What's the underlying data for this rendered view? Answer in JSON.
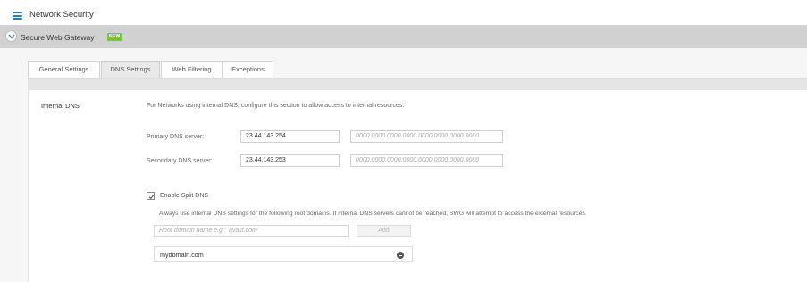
{
  "header": {
    "title": "Network Security",
    "menu_icon": "hamburger-icon"
  },
  "section": {
    "title": "Secure Web Gateway",
    "badge": "NEW",
    "toggle_icon": "chevron-down-icon"
  },
  "tabs": [
    {
      "label": "General Settings",
      "active": false
    },
    {
      "label": "DNS Settings",
      "active": true
    },
    {
      "label": "Web Filtering",
      "active": false
    },
    {
      "label": "Exceptions",
      "active": false
    }
  ],
  "internal_dns": {
    "label": "Internal DNS",
    "description": "For Networks using internal DNS, configure this section to allow access to internal resources.",
    "primary": {
      "label": "Primary DNS server:",
      "ipv4_value": "23.44.143.254",
      "ipv6_placeholder": "0000.0000.0000.0000.0000.0000.0000.0000"
    },
    "secondary": {
      "label": "Secondary DNS server:",
      "ipv4_value": "23.44.143.253",
      "ipv6_placeholder": "0000.0000.0000.0000.0000.0000.0000.0000"
    },
    "split_dns": {
      "label": "Enable Split DNS",
      "checked": true,
      "description": "Always use internal DNS settings for the following root domains. If internal DNS servers cannot be reached, SWG will attempt to access the external resources.",
      "root_placeholder": "Root domain name e.g.: 'avast.com'",
      "add_label": "Add",
      "domains": [
        "mydomain.com"
      ]
    }
  },
  "colors": {
    "accent": "#2b7bbd",
    "badge": "#7cc241",
    "section_bar": "#d1d1d1"
  }
}
